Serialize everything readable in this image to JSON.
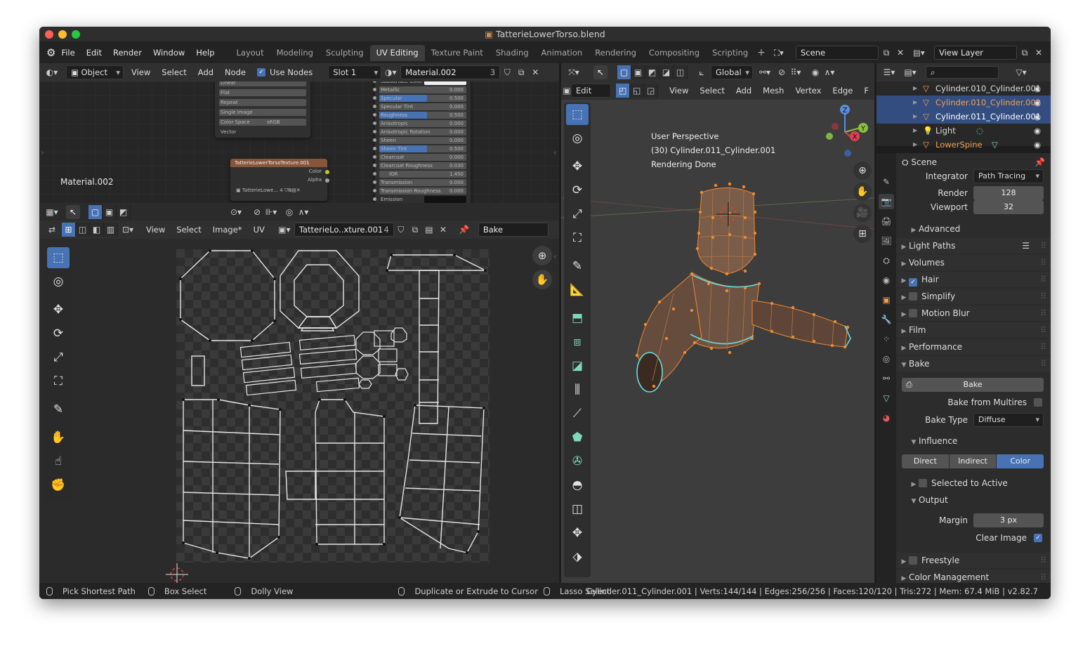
{
  "window": {
    "title": "TatterieLowerTorso.blend"
  },
  "menu": [
    "File",
    "Edit",
    "Render",
    "Window",
    "Help"
  ],
  "workspaces": [
    {
      "label": "Layout",
      "active": false
    },
    {
      "label": "Modeling",
      "active": false
    },
    {
      "label": "Sculpting",
      "active": false
    },
    {
      "label": "UV Editing",
      "active": true
    },
    {
      "label": "Texture Paint",
      "active": false
    },
    {
      "label": "Shading",
      "active": false
    },
    {
      "label": "Animation",
      "active": false
    },
    {
      "label": "Rendering",
      "active": false
    },
    {
      "label": "Compositing",
      "active": false
    },
    {
      "label": "Scripting",
      "active": false
    }
  ],
  "scene": {
    "name": "Scene",
    "view_layer": "View Layer"
  },
  "node_editor": {
    "header": {
      "mode": "Object",
      "menus": [
        "View",
        "Select",
        "Add",
        "Node"
      ],
      "use_nodes": "Use Nodes",
      "slot": "Slot 1",
      "material": "Material.002",
      "users": "3"
    },
    "label": "Material.002",
    "image_node": {
      "rows": [
        "Linear",
        "Flat",
        "Repeat",
        "Single Image"
      ],
      "color_space_label": "Color Space",
      "color_space": "sRGB",
      "vector": "Vector"
    },
    "texture_node": {
      "title": "TatterieLowerTorsoTexture.001",
      "outputs": [
        "Color",
        "Alpha"
      ],
      "image": "TatterieLowe...",
      "users": "4"
    },
    "bsdf": {
      "rows": [
        {
          "label": "Subsurface Color",
          "value": ""
        },
        {
          "label": "Metallic",
          "value": "0.000"
        },
        {
          "label": "Specular",
          "value": "0.500"
        },
        {
          "label": "Specular Tint",
          "value": "0.000"
        },
        {
          "label": "Roughness",
          "value": "0.500"
        },
        {
          "label": "Anisotropic",
          "value": "0.000"
        },
        {
          "label": "Anisotropic Rotation",
          "value": "0.000"
        },
        {
          "label": "Sheen",
          "value": "0.000"
        },
        {
          "label": "Sheen Tint",
          "value": "0.500"
        },
        {
          "label": "Clearcoat",
          "value": "0.000"
        },
        {
          "label": "Clearcoat Roughness",
          "value": "0.030"
        },
        {
          "label": "IOR",
          "value": "1.450"
        },
        {
          "label": "Transmission",
          "value": "0.000"
        },
        {
          "label": "Transmission Roughness",
          "value": "0.000"
        },
        {
          "label": "Emission",
          "value": ""
        }
      ]
    }
  },
  "uv_editor": {
    "menus": [
      "View",
      "Select",
      "Image*",
      "UV"
    ],
    "image": "TatterieLo..xture.001",
    "users": "4",
    "bake_field": "Bake"
  },
  "viewport": {
    "header": {
      "mode": "Edit Mode",
      "menus": [
        "View",
        "Select",
        "Add",
        "Mesh",
        "Vertex",
        "Edge",
        "F"
      ],
      "orientation": "Global"
    },
    "info": [
      "User Perspective",
      "(30) Cylinder.011_Cylinder.001",
      "Rendering Done"
    ],
    "gizmo": {
      "z": "Z",
      "y": "Y",
      "x": "X"
    }
  },
  "outliner": {
    "items": [
      {
        "name": "Cylinder.010_Cylinder.001",
        "highlight": false,
        "color": "#dddddd"
      },
      {
        "name": "Cylinder.010_Cylinder.002",
        "highlight": true,
        "color": "#f0a050"
      },
      {
        "name": "Cylinder.011_Cylinder.001",
        "highlight": true,
        "color": "#ffffff"
      },
      {
        "name": "Light",
        "highlight": false,
        "color": "#dddddd"
      },
      {
        "name": "LowerSpine",
        "highlight": false,
        "color": "#f0a050"
      }
    ]
  },
  "properties": {
    "scene": "Scene",
    "integrator_label": "Integrator",
    "integrator": "Path Tracing",
    "render_label": "Render",
    "render": "128",
    "viewport_label": "Viewport",
    "viewport": "32",
    "advanced": "Advanced",
    "sections": [
      "Light Paths",
      "Volumes",
      "Hair",
      "Simplify",
      "Motion Blur",
      "Film",
      "Performance",
      "Bake"
    ],
    "bake": {
      "button": "Bake",
      "from_multires": "Bake from Multires",
      "type_label": "Bake Type",
      "type": "Diffuse",
      "influence": "Influence",
      "direct": "Direct",
      "indirect": "Indirect",
      "color": "Color",
      "selected_to_active": "Selected to Active",
      "output": "Output",
      "margin_label": "Margin",
      "margin": "3 px",
      "clear_image": "Clear Image"
    },
    "more": [
      "Freestyle",
      "Color Management"
    ]
  },
  "status": {
    "items": [
      "Pick Shortest Path",
      "Box Select",
      "Dolly View",
      "Duplicate or Extrude to Cursor",
      "Lasso Select"
    ],
    "stats": "Cylinder.011_Cylinder.001 | Verts:144/144 | Edges:256/256 | Faces:120/120 | Tris:272 | Mem: 67.4 MiB | v2.82.7"
  },
  "colors": {
    "accent": "#4772b3",
    "selection": "#f0a050",
    "highlight": "#334d80"
  }
}
